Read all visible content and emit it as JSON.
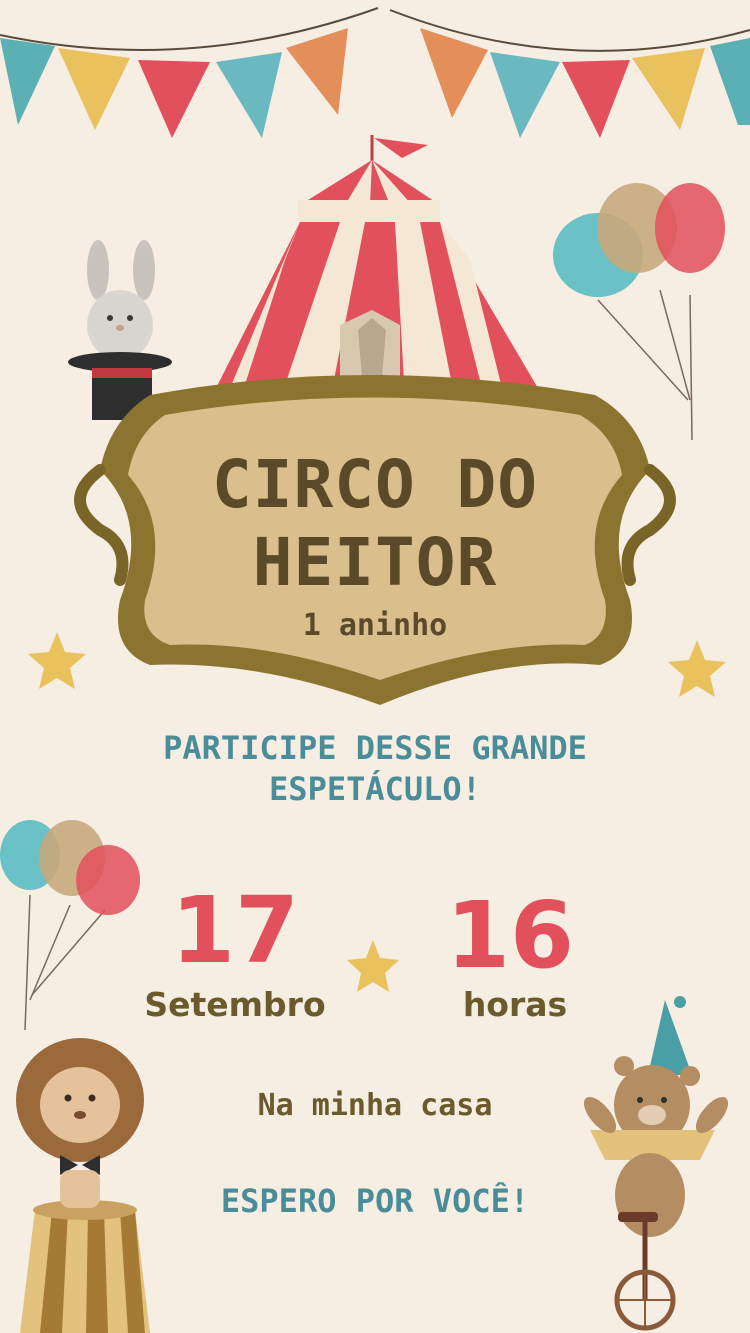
{
  "title_line1": "CIRCO DO",
  "title_line2": "HEITOR",
  "subtitle": "1 aninho",
  "invite_line1": "PARTICIPE DESSE GRANDE",
  "invite_line2": "ESPETÁCULO!",
  "date": {
    "day": "17",
    "month": "Setembro"
  },
  "time": {
    "hour": "16",
    "unit": "horas"
  },
  "location": "Na minha casa",
  "closing": "ESPERO POR VOCÊ!",
  "colors": {
    "background": "#f6ede3",
    "title_brown": "#5b4a2a",
    "teal": "#4a8d98",
    "red": "#e2505c",
    "gold": "#e9c15d"
  }
}
